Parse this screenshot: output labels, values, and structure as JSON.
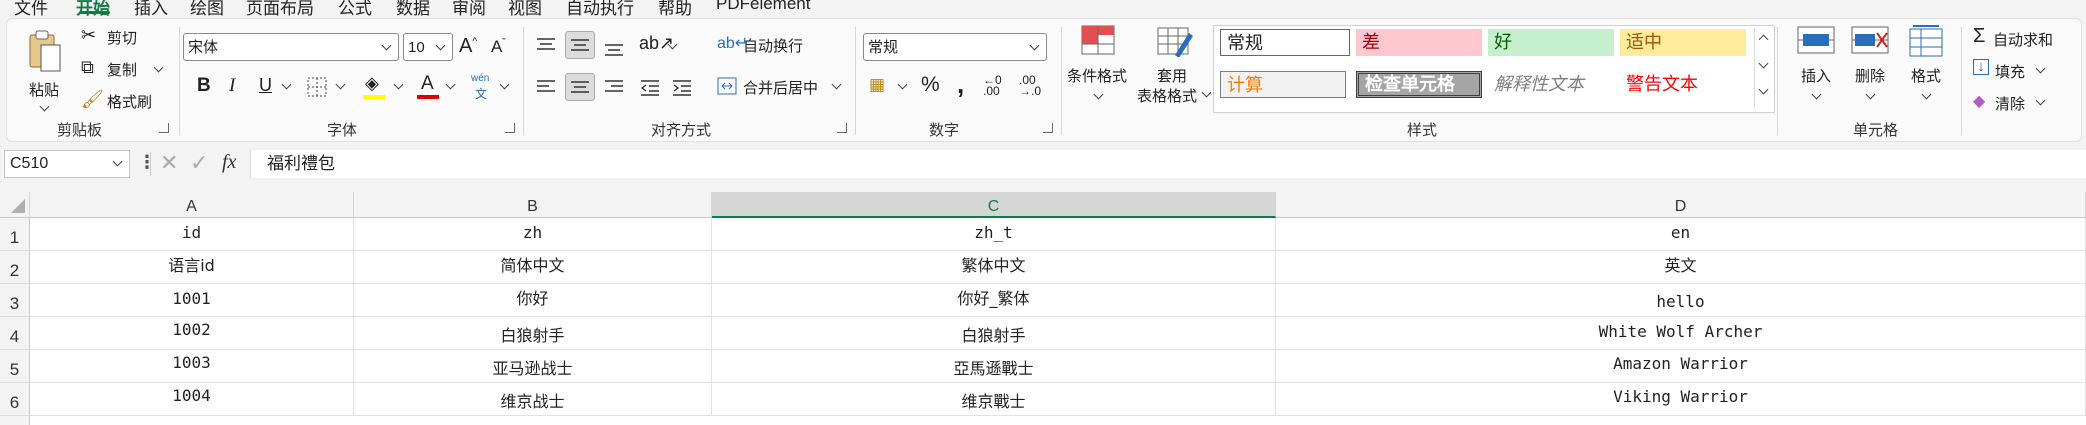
{
  "menu": {
    "items": [
      "文件",
      "开始",
      "插入",
      "绘图",
      "页面布局",
      "公式",
      "数据",
      "审阅",
      "视图",
      "自动执行",
      "帮助",
      "PDFelement"
    ],
    "active": "开始"
  },
  "ribbon": {
    "clipboard": {
      "paste": "粘贴",
      "cut": "剪切",
      "copy": "复制",
      "format_painter": "格式刷",
      "label": "剪贴板"
    },
    "font": {
      "name": "宋体",
      "size": "10",
      "label": "字体",
      "phonetic": "wén"
    },
    "alignment": {
      "wrap": "自动换行",
      "merge": "合并后居中",
      "label": "对齐方式"
    },
    "number": {
      "format": "常规",
      "label": "数字"
    },
    "styles": {
      "conditional": "条件格式",
      "table_line1": "套用",
      "table_line2": "表格格式",
      "cells": [
        "常规",
        "差",
        "好",
        "适中",
        "计算",
        "检查单元格",
        "解释性文本",
        "警告文本"
      ],
      "label": "样式"
    },
    "cells": {
      "insert": "插入",
      "delete": "删除",
      "format": "格式",
      "label": "单元格"
    },
    "editing": {
      "autosum": "自动求和",
      "fill": "填充",
      "clear": "清除"
    }
  },
  "formula_bar": {
    "name_box": "C510",
    "fx": "fx",
    "content": "福利禮包"
  },
  "grid": {
    "columns": [
      "A",
      "B",
      "C",
      "D"
    ],
    "selected_column": "C",
    "row_numbers": [
      "1",
      "2",
      "3",
      "4",
      "5",
      "6"
    ],
    "rows": [
      [
        "id",
        "zh",
        "zh_t",
        "en"
      ],
      [
        "语言id",
        "简体中文",
        "繁体中文",
        "英文"
      ],
      [
        "1001",
        "你好",
        "你好_繁体",
        "hello"
      ],
      [
        "1002",
        "白狼射手",
        "白狼射手",
        "White Wolf Archer"
      ],
      [
        "1003",
        "亚马逊战士",
        "亞馬遜戰士",
        "Amazon Warrior"
      ],
      [
        "1004",
        "维京战士",
        "维京戰士",
        "Viking Warrior"
      ]
    ]
  },
  "colors": {
    "accent": "#107c41",
    "bad_bg": "#ffc7ce",
    "bad_fg": "#9c0006",
    "good_bg": "#c6efce",
    "good_fg": "#006100",
    "neutral_bg": "#ffeb9c",
    "neutral_fg": "#9c5700",
    "calc_fg": "#fa7d00",
    "check_bg": "#a5a5a5",
    "warn_fg": "#ff0000"
  }
}
